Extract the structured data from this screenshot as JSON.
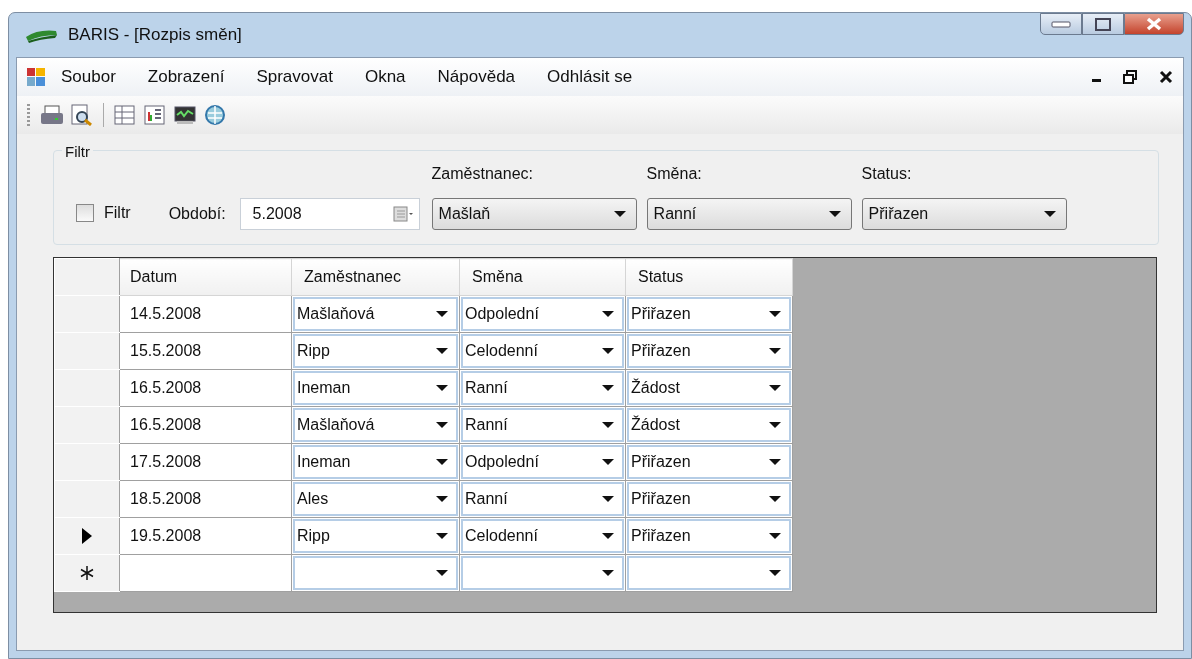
{
  "window": {
    "title": "BARIS - [Rozpis směn]"
  },
  "menu": [
    "Soubor",
    "Zobrazení",
    "Spravovat",
    "Okna",
    "Nápověda",
    "Odhlásit se"
  ],
  "filter": {
    "title": "Filtr",
    "checkbox": {
      "label": "Filtr",
      "checked": false
    },
    "period": {
      "label": "Období:",
      "value": "5.2008"
    },
    "combos": [
      {
        "label": "Zaměstnanec:",
        "value": "Mašlaň"
      },
      {
        "label": "Směna:",
        "value": "Ranní"
      },
      {
        "label": "Status:",
        "value": "Přiřazen"
      }
    ]
  },
  "table": {
    "columns": [
      "Datum",
      "Zaměstnanec",
      "Směna",
      "Status"
    ],
    "rows": [
      {
        "kind": "data",
        "selected": false,
        "cells": [
          "14.5.2008",
          "Mašlaňová",
          "Odpolední",
          "Přiřazen"
        ]
      },
      {
        "kind": "data",
        "selected": false,
        "cells": [
          "15.5.2008",
          "Ripp",
          "Celodenní",
          "Přiřazen"
        ]
      },
      {
        "kind": "data",
        "selected": false,
        "cells": [
          "16.5.2008",
          "Ineman",
          "Ranní",
          "Žádost"
        ]
      },
      {
        "kind": "data",
        "selected": false,
        "cells": [
          "16.5.2008",
          "Mašlaňová",
          "Ranní",
          "Žádost"
        ]
      },
      {
        "kind": "data",
        "selected": false,
        "cells": [
          "17.5.2008",
          "Ineman",
          "Odpolední",
          "Přiřazen"
        ]
      },
      {
        "kind": "data",
        "selected": false,
        "cells": [
          "18.5.2008",
          "Ales",
          "Ranní",
          "Přiřazen"
        ]
      },
      {
        "kind": "data",
        "selected": true,
        "cells": [
          "19.5.2008",
          "Ripp",
          "Celodenní",
          "Přiřazen"
        ]
      },
      {
        "kind": "new",
        "selected": false
      }
    ]
  }
}
